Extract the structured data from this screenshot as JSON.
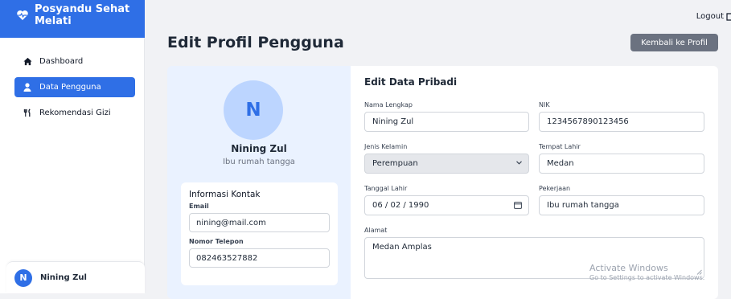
{
  "sidebar": {
    "brand": "Posyandu Sehat Melati",
    "items": [
      {
        "label": "Dashboard",
        "icon": "home-icon"
      },
      {
        "label": "Data Pengguna",
        "icon": "user-icon"
      },
      {
        "label": "Rekomendasi Gizi",
        "icon": "utensils-icon"
      }
    ],
    "user": {
      "initial": "N",
      "name": "Nining Zul"
    }
  },
  "topbar": {
    "logout": "Logout"
  },
  "page": {
    "title": "Edit Profil Pengguna",
    "back_button": "Kembali ke Profil"
  },
  "profile": {
    "initial": "N",
    "name": "Nining Zul",
    "job": "Ibu rumah tangga",
    "contact": {
      "title": "Informasi Kontak",
      "email_label": "Email",
      "email": "nining@mail.com",
      "phone_label": "Nomor Telepon",
      "phone": "082463527882"
    }
  },
  "form": {
    "title": "Edit Data Pribadi",
    "nama_label": "Nama Lengkap",
    "nama": "Nining Zul",
    "nik_label": "NIK",
    "nik": "1234567890123456",
    "jk_label": "Jenis Kelamin",
    "jk": "Perempuan",
    "tempat_label": "Tempat Lahir",
    "tempat": "Medan",
    "tanggal_label": "Tanggal Lahir",
    "tanggal": "06 / 02 / 1990",
    "pekerjaan_label": "Pekerjaan",
    "pekerjaan": "Ibu rumah tangga",
    "alamat_label": "Alamat",
    "alamat": "Medan Amplas"
  },
  "watermark": {
    "line1": "Activate Windows",
    "line2": "Go to Settings to activate Windows."
  },
  "colors": {
    "accent": "#2f6fe6",
    "avatar_bg": "#bcd5ff",
    "button_gray": "#6b7280"
  }
}
